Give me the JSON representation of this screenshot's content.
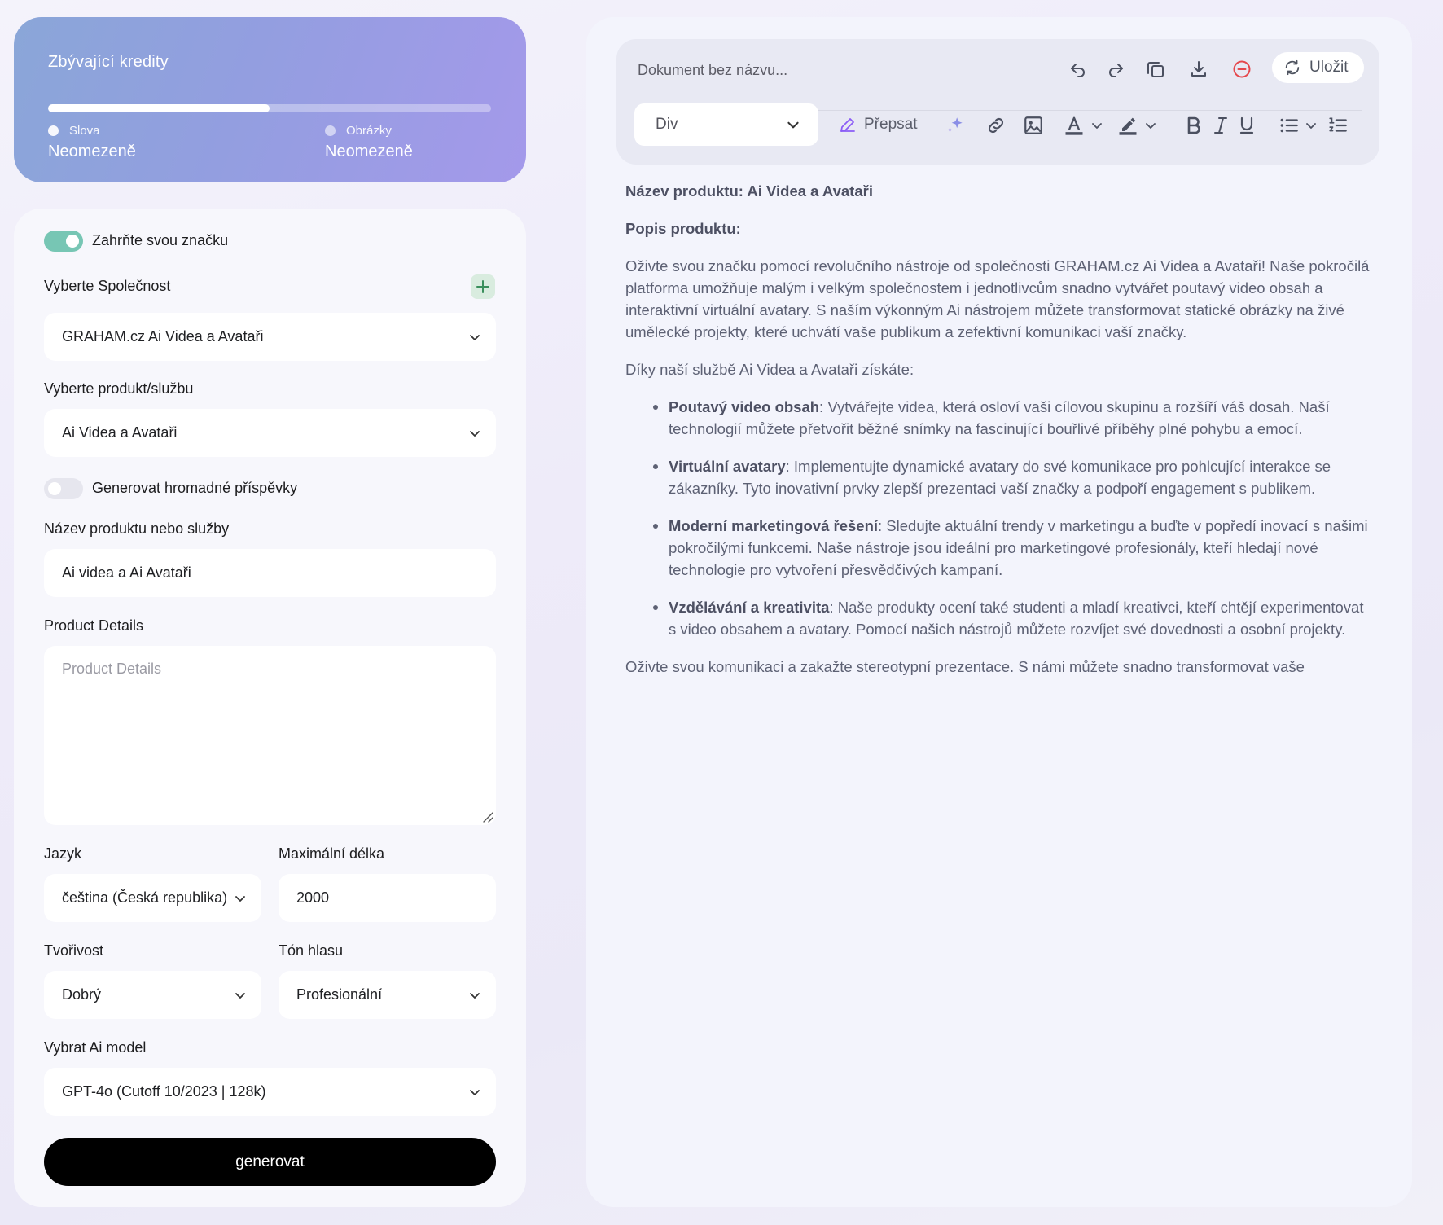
{
  "credits": {
    "title": "Zbývající kredity",
    "progress": 0.5,
    "words_label": "Slova",
    "words_value": "Neomezeně",
    "images_label": "Obrázky",
    "images_value": "Neomezeně"
  },
  "form": {
    "brand_toggle_label": "Zahrňte svou značku",
    "brand_toggle_on": true,
    "company_label": "Vyberte Společnost",
    "company_value": "GRAHAM.cz Ai Videa a Avataři",
    "product_select_label": "Vyberte produkt/službu",
    "product_select_value": "Ai Videa a Avataři",
    "bulk_toggle_label": "Generovat hromadné příspěvky",
    "bulk_toggle_on": false,
    "product_name_label": "Název produktu nebo služby",
    "product_name_value": "Ai videa a Ai Avataři",
    "details_label": "Product Details",
    "details_placeholder": "Product Details",
    "language_label": "Jazyk",
    "language_value": "čeština (Česká republika)",
    "max_length_label": "Maximální délka",
    "max_length_value": "2000",
    "creativity_label": "Tvořivost",
    "creativity_value": "Dobrý",
    "tone_label": "Tón hlasu",
    "tone_value": "Profesionální",
    "model_label": "Vybrat Ai model",
    "model_value": "GPT-4o (Cutoff 10/2023 | 128k)",
    "generate_label": "generovat"
  },
  "editor": {
    "doc_name": "Dokument bez názvu...",
    "save_label": "Uložit",
    "block_select": "Div",
    "rewrite_label": "Přepsat",
    "accent": "#8b5cf6",
    "danger": "#e5484d",
    "content": {
      "name_line": "Název produktu: Ai Videa a Avataři",
      "desc_heading": "Popis produktu:",
      "intro": "Oživte svou značku pomocí revolučního nástroje od společnosti GRAHAM.cz Ai Videa a Avataři! Naše pokročilá platforma umožňuje malým i velkým společnostem i jednotlivcům snadno vytvářet poutavý video obsah a interaktivní virtuální avatary. S naším výkonným Ai nástrojem můžete transformovat statické obrázky na živé umělecké projekty, které uchvátí vaše publikum a zefektivní komunikaci vaší značky.",
      "lead": "Díky naší službě Ai Videa a Avataři získáte:",
      "bullets": [
        {
          "title": "Poutavý video obsah",
          "text": ": Vytvářejte videa, která osloví vaši cílovou skupinu a rozšíří váš dosah. Naší technologií můžete přetvořit běžné snímky na fascinující bouřlivé příběhy plné pohybu a emocí."
        },
        {
          "title": "Virtuální avatary",
          "text": ": Implementujte dynamické avatary do své komunikace pro pohlcující interakce se zákazníky. Tyto inovativní prvky zlepší prezentaci vaší značky a podpoří engagement s publikem."
        },
        {
          "title": "Moderní marketingová řešení",
          "text": ": Sledujte aktuální trendy v marketingu a buďte v popředí inovací s našimi pokročilými funkcemi. Naše nástroje jsou ideální pro marketingové profesionály, kteří hledají nové technologie pro vytvoření přesvědčivých kampaní."
        },
        {
          "title": "Vzdělávání a kreativita",
          "text": ": Naše produkty ocení také studenti a mladí kreativci, kteří chtějí experimentovat s video obsahem a avatary. Pomocí našich nástrojů můžete rozvíjet své dovednosti a osobní projekty."
        }
      ],
      "closing": "Oživte svou komunikaci a zakažte stereotypní prezentace. S námi můžete snadno transformovat vaše"
    }
  }
}
